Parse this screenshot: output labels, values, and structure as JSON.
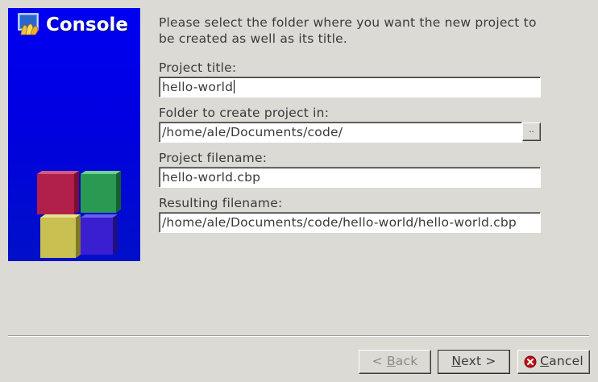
{
  "banner": {
    "title": "Console",
    "icon": "codeblocks-logo-icon"
  },
  "intro": "Please select the folder where you want the new project to be created as well as its title.",
  "fields": {
    "title": {
      "label": "Project title:",
      "value": "hello-world"
    },
    "folder": {
      "label": "Folder to create project in:",
      "value": "/home/ale/Documents/code/",
      "browse_label": ".."
    },
    "filename": {
      "label": "Project filename:",
      "value": "hello-world.cbp"
    },
    "resulting": {
      "label": "Resulting filename:",
      "value": "/home/ale/Documents/code/hello-world/hello-world.cbp"
    }
  },
  "buttons": {
    "back": {
      "prefix": "< ",
      "accel": "B",
      "rest": "ack"
    },
    "next": {
      "prefix": "",
      "accel": "N",
      "rest": "ext >"
    },
    "cancel": {
      "accel": "C",
      "rest": "ancel",
      "icon": "cancel-x-icon"
    }
  },
  "colors": {
    "banner_blue": "#0000f2",
    "cube_red": "#b0204a",
    "cube_green": "#2a9a52",
    "cube_yellow": "#c8c050",
    "cube_purple": "#3a1fd0",
    "cancel_red": "#c0101a"
  }
}
